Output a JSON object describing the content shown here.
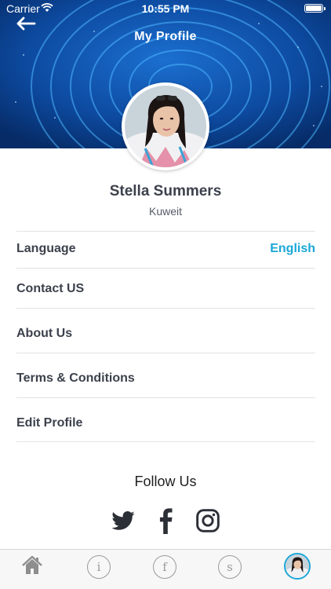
{
  "status_bar": {
    "carrier": "Carrier",
    "time": "10:55 PM"
  },
  "header": {
    "title": "My Profile"
  },
  "profile": {
    "name": "Stella Summers",
    "location": "Kuweit"
  },
  "menu": {
    "items": [
      {
        "label": "Language",
        "value": "English"
      },
      {
        "label": "Contact US"
      },
      {
        "label": "About Us"
      },
      {
        "label": "Terms & Conditions"
      },
      {
        "label": "Edit Profile"
      }
    ]
  },
  "follow": {
    "title": "Follow Us",
    "links": [
      "twitter-icon",
      "facebook-icon",
      "instagram-icon"
    ]
  },
  "tabbar": {
    "tabs": [
      {
        "icon": "home-icon"
      },
      {
        "icon": "info-icon",
        "glyph": "i"
      },
      {
        "icon": "facebook-icon",
        "glyph": "f"
      },
      {
        "icon": "snapchat-icon",
        "glyph": "s"
      },
      {
        "icon": "avatar"
      }
    ]
  },
  "colors": {
    "header_blue": "#0b3e8a",
    "accent": "#1aa7d8",
    "text_dark": "#3c414c",
    "divider": "#e3e3e3"
  }
}
